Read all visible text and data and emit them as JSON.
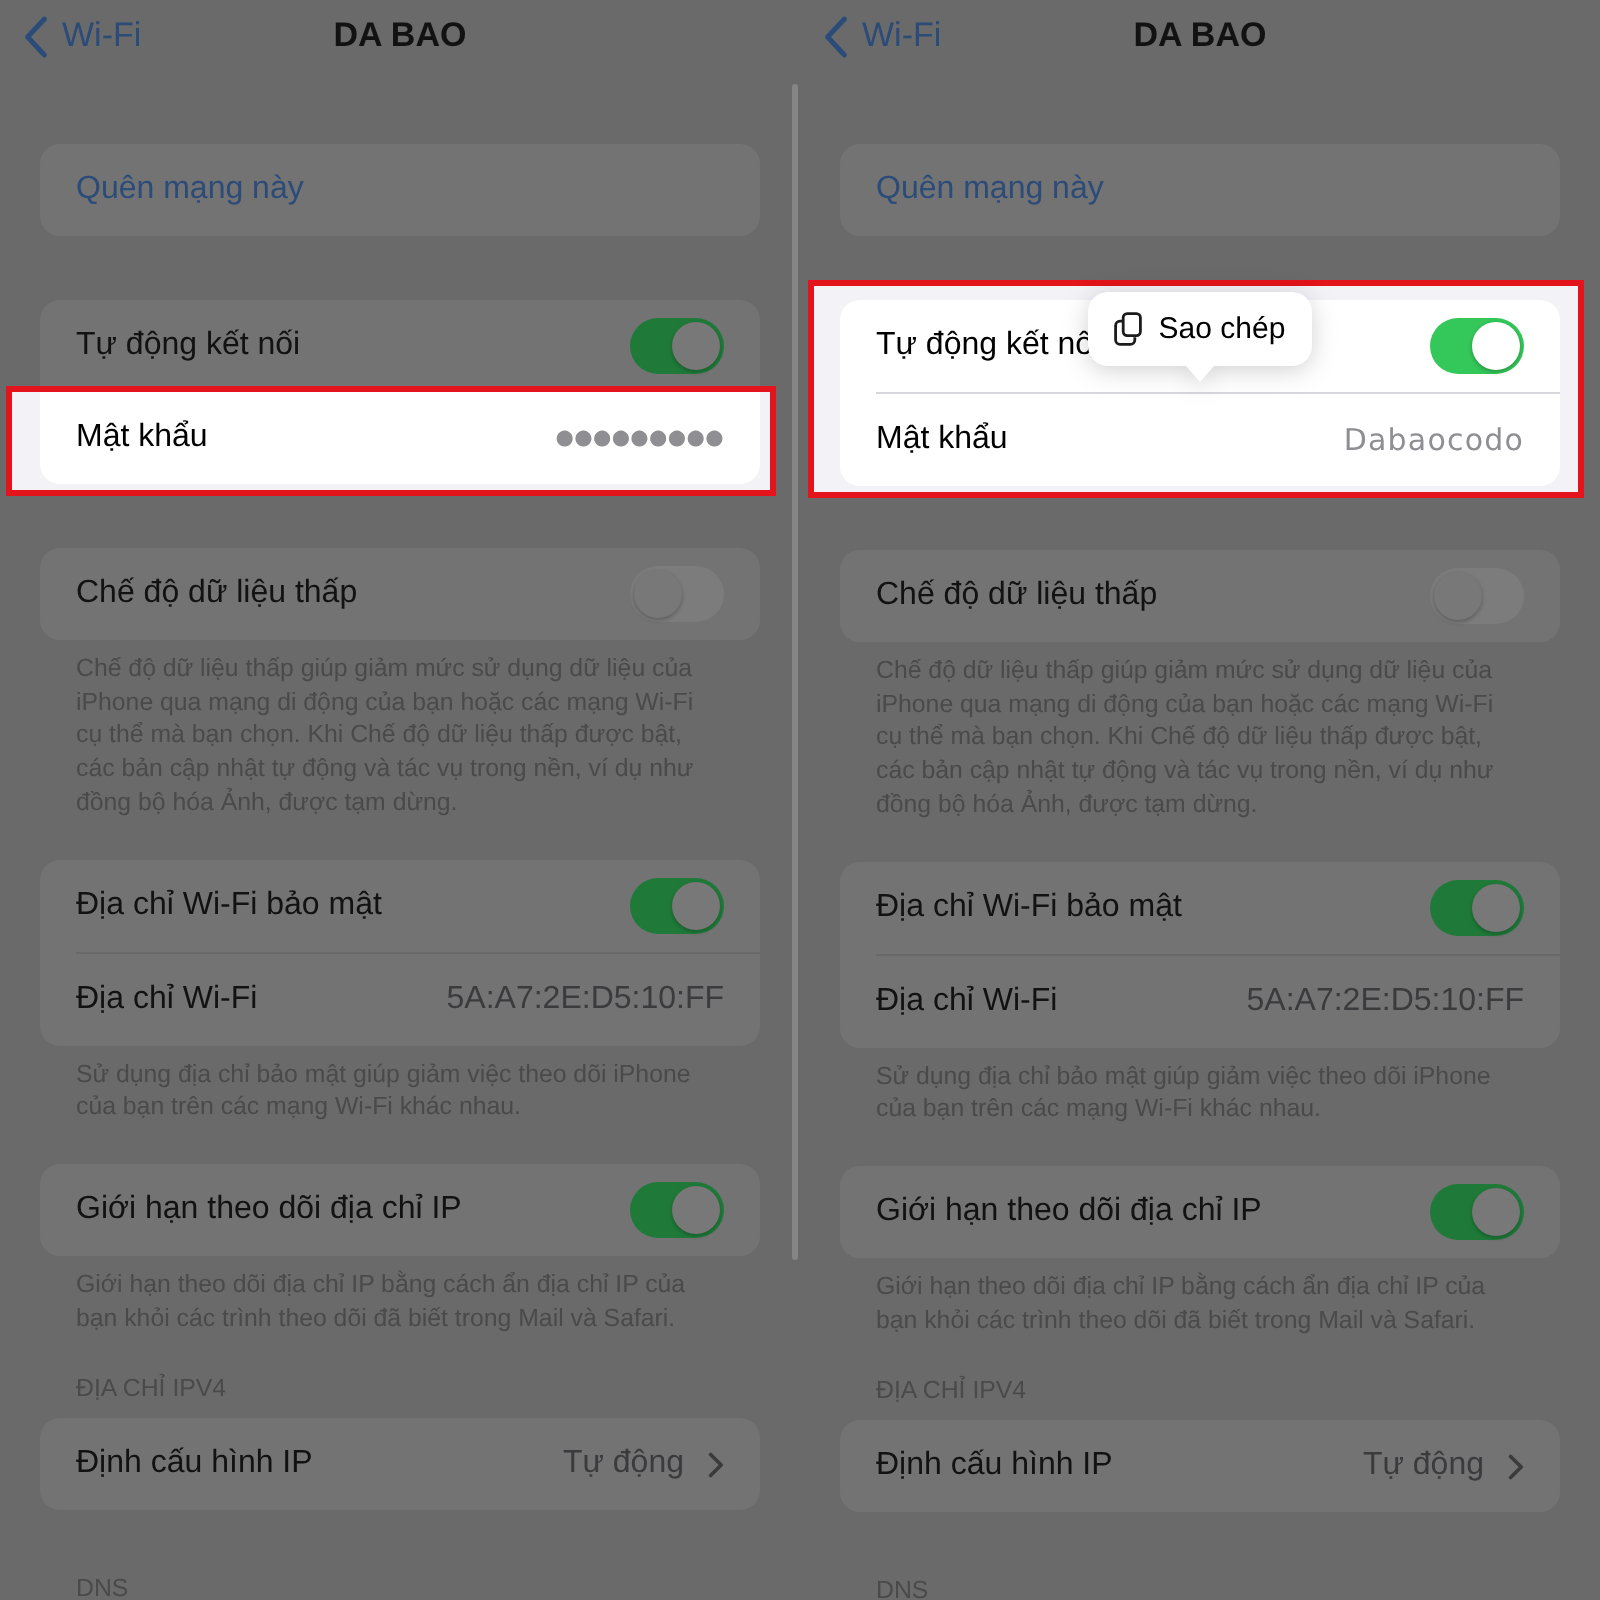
{
  "panels": [
    {
      "nav": {
        "back_label": "Wi-Fi",
        "title": "DA BAO"
      },
      "sections": [
        {
          "rows": [
            {
              "kind": "action",
              "label": "Quên mạng này",
              "highlighted": false
            }
          ]
        },
        {
          "rows": [
            {
              "kind": "toggle",
              "label": "Tự động kết nối",
              "on": true,
              "highlighted": false
            },
            {
              "kind": "password",
              "label": "Mật khẩu",
              "value": "●●●●●●●●●",
              "masked": true,
              "highlighted": true
            }
          ]
        },
        {
          "rows": [
            {
              "kind": "toggle",
              "label": "Chế độ dữ liệu thấp",
              "on": false,
              "highlighted": false
            }
          ],
          "footer": "Chế độ dữ liệu thấp giúp giảm mức sử dụng dữ liệu của iPhone qua mạng di động của bạn hoặc các mạng Wi-Fi cụ thể mà bạn chọn. Khi Chế độ dữ liệu thấp được bật, các bản cập nhật tự động và tác vụ trong nền, ví dụ như đồng bộ hóa Ảnh, được tạm dừng."
        },
        {
          "rows": [
            {
              "kind": "toggle",
              "label": "Địa chỉ Wi-Fi bảo mật",
              "on": true,
              "highlighted": false
            },
            {
              "kind": "value",
              "label": "Địa chỉ Wi-Fi",
              "value": "5A:A7:2E:D5:10:FF",
              "highlighted": false
            }
          ],
          "footer": "Sử dụng địa chỉ bảo mật giúp giảm việc theo dõi iPhone của bạn trên các mạng Wi-Fi khác nhau."
        },
        {
          "rows": [
            {
              "kind": "toggle",
              "label": "Giới hạn theo dõi địa chỉ IP",
              "on": true,
              "highlighted": false
            }
          ],
          "footer": "Giới hạn theo dõi địa chỉ IP bằng cách ẩn địa chỉ IP của bạn khỏi các trình theo dõi đã biết trong Mail và Safari."
        },
        {
          "header": "ĐỊA CHỈ IPV4",
          "rows": [
            {
              "kind": "disclosure",
              "label": "Định cấu hình IP",
              "value": "Tự động",
              "highlighted": false
            }
          ]
        },
        {
          "header": "DNS"
        }
      ]
    },
    {
      "nav": {
        "back_label": "Wi-Fi",
        "title": "DA BAO"
      },
      "sections": [
        {
          "rows": [
            {
              "kind": "action",
              "label": "Quên mạng này",
              "highlighted": false
            }
          ]
        },
        {
          "rows": [
            {
              "kind": "toggle",
              "label": "Tự động kết nố",
              "on": true,
              "highlighted": true
            },
            {
              "kind": "password",
              "label": "Mật khẩu",
              "value": "Dabaocodo",
              "masked": false,
              "highlighted": true,
              "context_menu": {
                "label": "Sao chép"
              }
            }
          ]
        },
        {
          "rows": [
            {
              "kind": "toggle",
              "label": "Chế độ dữ liệu thấp",
              "on": false,
              "highlighted": false
            }
          ],
          "footer": "Chế độ dữ liệu thấp giúp giảm mức sử dụng dữ liệu của iPhone qua mạng di động của bạn hoặc các mạng Wi-Fi cụ thể mà bạn chọn. Khi Chế độ dữ liệu thấp được bật, các bản cập nhật tự động và tác vụ trong nền, ví dụ như đồng bộ hóa Ảnh, được tạm dừng."
        },
        {
          "rows": [
            {
              "kind": "toggle",
              "label": "Địa chỉ Wi-Fi bảo mật",
              "on": true,
              "highlighted": false
            },
            {
              "kind": "value",
              "label": "Địa chỉ Wi-Fi",
              "value": "5A:A7:2E:D5:10:FF",
              "highlighted": false
            }
          ],
          "footer": "Sử dụng địa chỉ bảo mật giúp giảm việc theo dõi iPhone của bạn trên các mạng Wi-Fi khác nhau."
        },
        {
          "rows": [
            {
              "kind": "toggle",
              "label": "Giới hạn theo dõi địa chỉ IP",
              "on": true,
              "highlighted": false
            }
          ],
          "footer": "Giới hạn theo dõi địa chỉ IP bằng cách ẩn địa chỉ IP của bạn khỏi các trình theo dõi đã biết trong Mail và Safari."
        },
        {
          "header": "ĐỊA CHỈ IPV4",
          "rows": [
            {
              "kind": "disclosure",
              "label": "Định cấu hình IP",
              "value": "Tự động",
              "highlighted": false
            }
          ]
        },
        {
          "header": "DNS"
        }
      ]
    }
  ]
}
